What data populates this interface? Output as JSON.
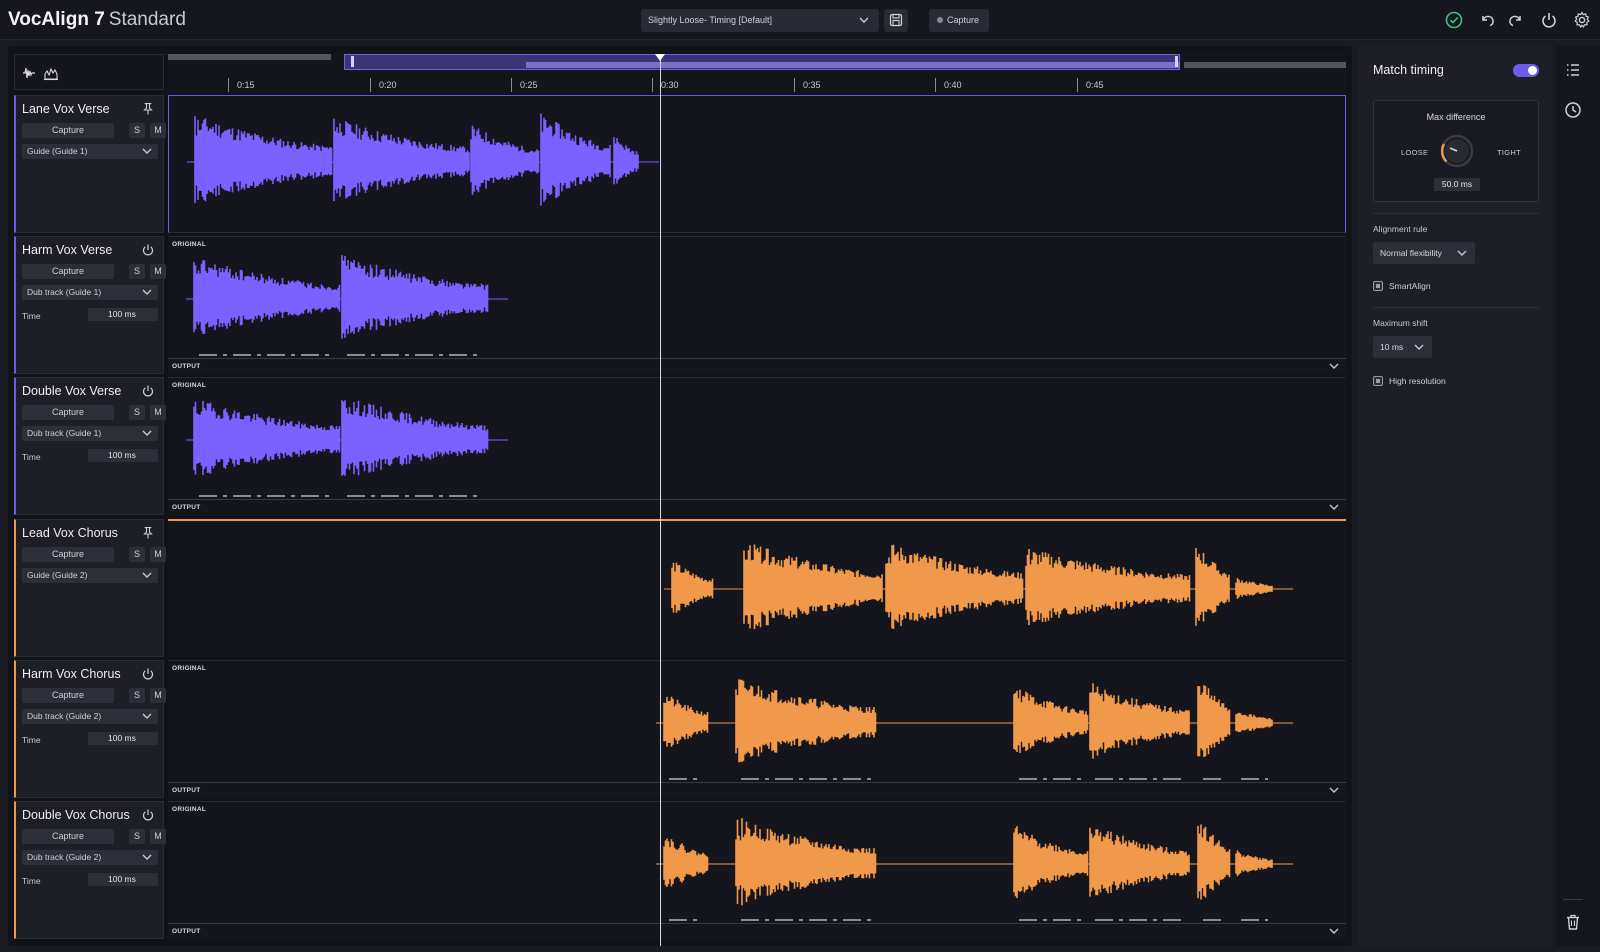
{
  "app": {
    "brand_bold": "VocAlign 7",
    "brand_light": "Standard"
  },
  "toolbar": {
    "preset": "Slightly Loose- Timing [Default]",
    "capture_label": "Capture",
    "icons": [
      "save-icon",
      "check-circle-icon",
      "undo-icon",
      "redo-icon",
      "power-icon",
      "gear-icon"
    ]
  },
  "ruler": {
    "ticks": [
      "0:15",
      "0:20",
      "0:25",
      "0:30",
      "0:35",
      "0:40",
      "0:45"
    ]
  },
  "tracks": [
    {
      "name": "Lane Vox Verse",
      "capture": "Capture",
      "solo": "S",
      "mute": "M",
      "role": "Guide (Guide 1)",
      "color": "#7b61ff",
      "guide": true
    },
    {
      "name": "Harm Vox Verse",
      "capture": "Capture",
      "solo": "S",
      "mute": "M",
      "role": "Dub track (Guide 1)",
      "time_label": "Time",
      "time_value": "100 ms",
      "color": "#7b61ff",
      "original_label": "ORIGINAL",
      "output_label": "OUTPUT"
    },
    {
      "name": "Double Vox Verse",
      "capture": "Capture",
      "solo": "S",
      "mute": "M",
      "role": "Dub track (Guide 1)",
      "time_label": "Time",
      "time_value": "100 ms",
      "color": "#7b61ff",
      "original_label": "ORIGINAL",
      "output_label": "OUTPUT"
    },
    {
      "name": "Lead Vox Chorus",
      "capture": "Capture",
      "solo": "S",
      "mute": "M",
      "role": "Guide (Guide 2)",
      "color": "#f0994a",
      "guide": true
    },
    {
      "name": "Harm Vox Chorus",
      "capture": "Capture",
      "solo": "S",
      "mute": "M",
      "role": "Dub track (Guide 2)",
      "time_label": "Time",
      "time_value": "100 ms",
      "color": "#f0994a",
      "original_label": "ORIGINAL",
      "output_label": "OUTPUT"
    },
    {
      "name": "Double Vox Chorus",
      "capture": "Capture",
      "solo": "S",
      "mute": "M",
      "role": "Dub track (Guide 2)",
      "time_label": "Time",
      "time_value": "100 ms",
      "color": "#f0994a",
      "original_label": "ORIGINAL",
      "output_label": "OUTPUT"
    }
  ],
  "panel": {
    "title": "Match timing",
    "toggle_on": true,
    "max_difference": {
      "title": "Max difference",
      "loose": "LOOSE",
      "tight": "TIGHT",
      "value": "50.0 ms"
    },
    "alignment_rule_label": "Alignment rule",
    "alignment_rule_value": "Normal flexibility",
    "smartalign_label": "SmartAlign",
    "maximum_shift_label": "Maximum shift",
    "maximum_shift_value": "10 ms",
    "high_resolution_label": "High resolution"
  },
  "colors": {
    "accent": "#6c5ce7",
    "guide1": "#7b61ff",
    "guide2": "#f0994a"
  }
}
